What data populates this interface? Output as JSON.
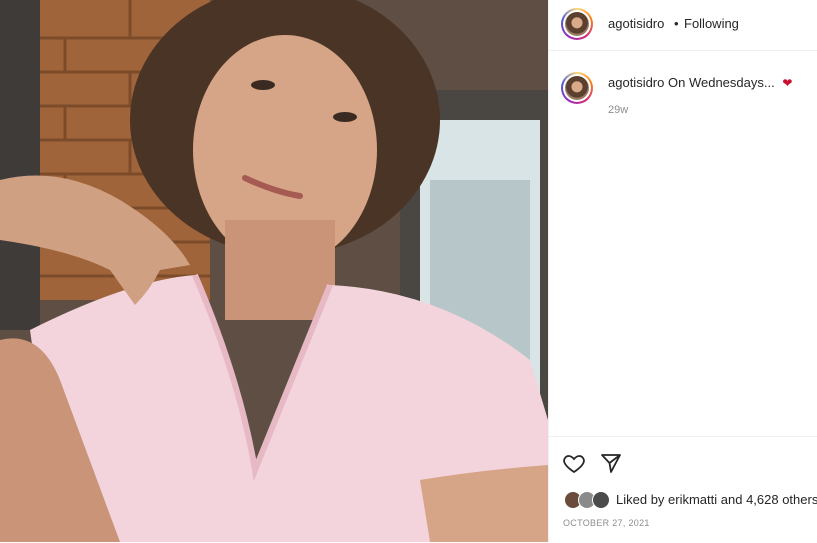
{
  "post": {
    "username": "agotisidro",
    "separator": "•",
    "follow_status": "Following",
    "caption_user": "agotisidro",
    "caption_text": "On Wednesdays...",
    "caption_emoji": "❤",
    "age": "29w",
    "likes_text": "Liked by erikmatti and 4,628 others",
    "date": "OCTOBER 27, 2021"
  },
  "icons": {
    "like": "heart-outline-icon",
    "share": "paper-plane-icon"
  },
  "colors": {
    "text": "#262626",
    "muted": "#8e8e8e",
    "border": "#efefef"
  }
}
